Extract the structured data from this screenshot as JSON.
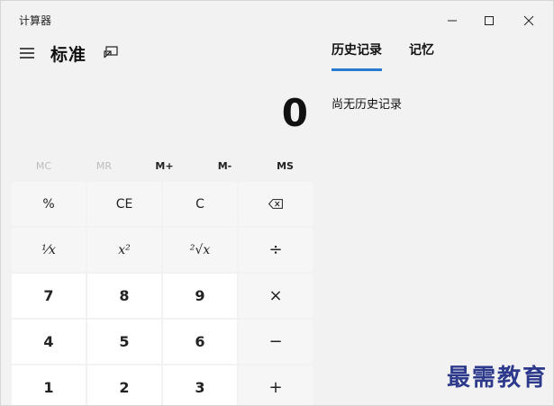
{
  "window": {
    "title": "计算器"
  },
  "header": {
    "mode_title": "标准"
  },
  "display": {
    "value": "0"
  },
  "memory": {
    "items": [
      "MC",
      "MR",
      "M+",
      "M-",
      "MS"
    ]
  },
  "keypad": {
    "rows": [
      [
        "%",
        "CE",
        "C",
        "backspace"
      ],
      [
        "1/x",
        "x²",
        "²√x",
        "÷"
      ],
      [
        "7",
        "8",
        "9",
        "×"
      ],
      [
        "4",
        "5",
        "6",
        "−"
      ],
      [
        "1",
        "2",
        "3",
        "+"
      ]
    ],
    "labels": {
      "percent": "%",
      "ce": "CE",
      "c": "C",
      "reciprocal": "¹⁄x",
      "square": "x²",
      "sqrt": "²√x",
      "divide": "÷",
      "seven": "7",
      "eight": "8",
      "nine": "9",
      "multiply": "×",
      "four": "4",
      "five": "5",
      "six": "6",
      "minus": "−",
      "one": "1",
      "two": "2",
      "three": "3",
      "plus": "+"
    }
  },
  "side_panel": {
    "tabs": [
      {
        "label": "历史记录",
        "active": true
      },
      {
        "label": "记忆",
        "active": false
      }
    ],
    "history_empty_text": "尚无历史记录"
  },
  "watermark": "最需教育",
  "colors": {
    "accent": "#2a7bd0",
    "window_bg": "#f2f2f2",
    "watermark": "#2d3a8c"
  },
  "icons": {
    "menu": "hamburger-icon",
    "keep_on_top": "keep-on-top-icon",
    "minimize": "minimize-icon",
    "maximize": "maximize-icon",
    "close": "close-icon",
    "backspace": "backspace-icon"
  }
}
